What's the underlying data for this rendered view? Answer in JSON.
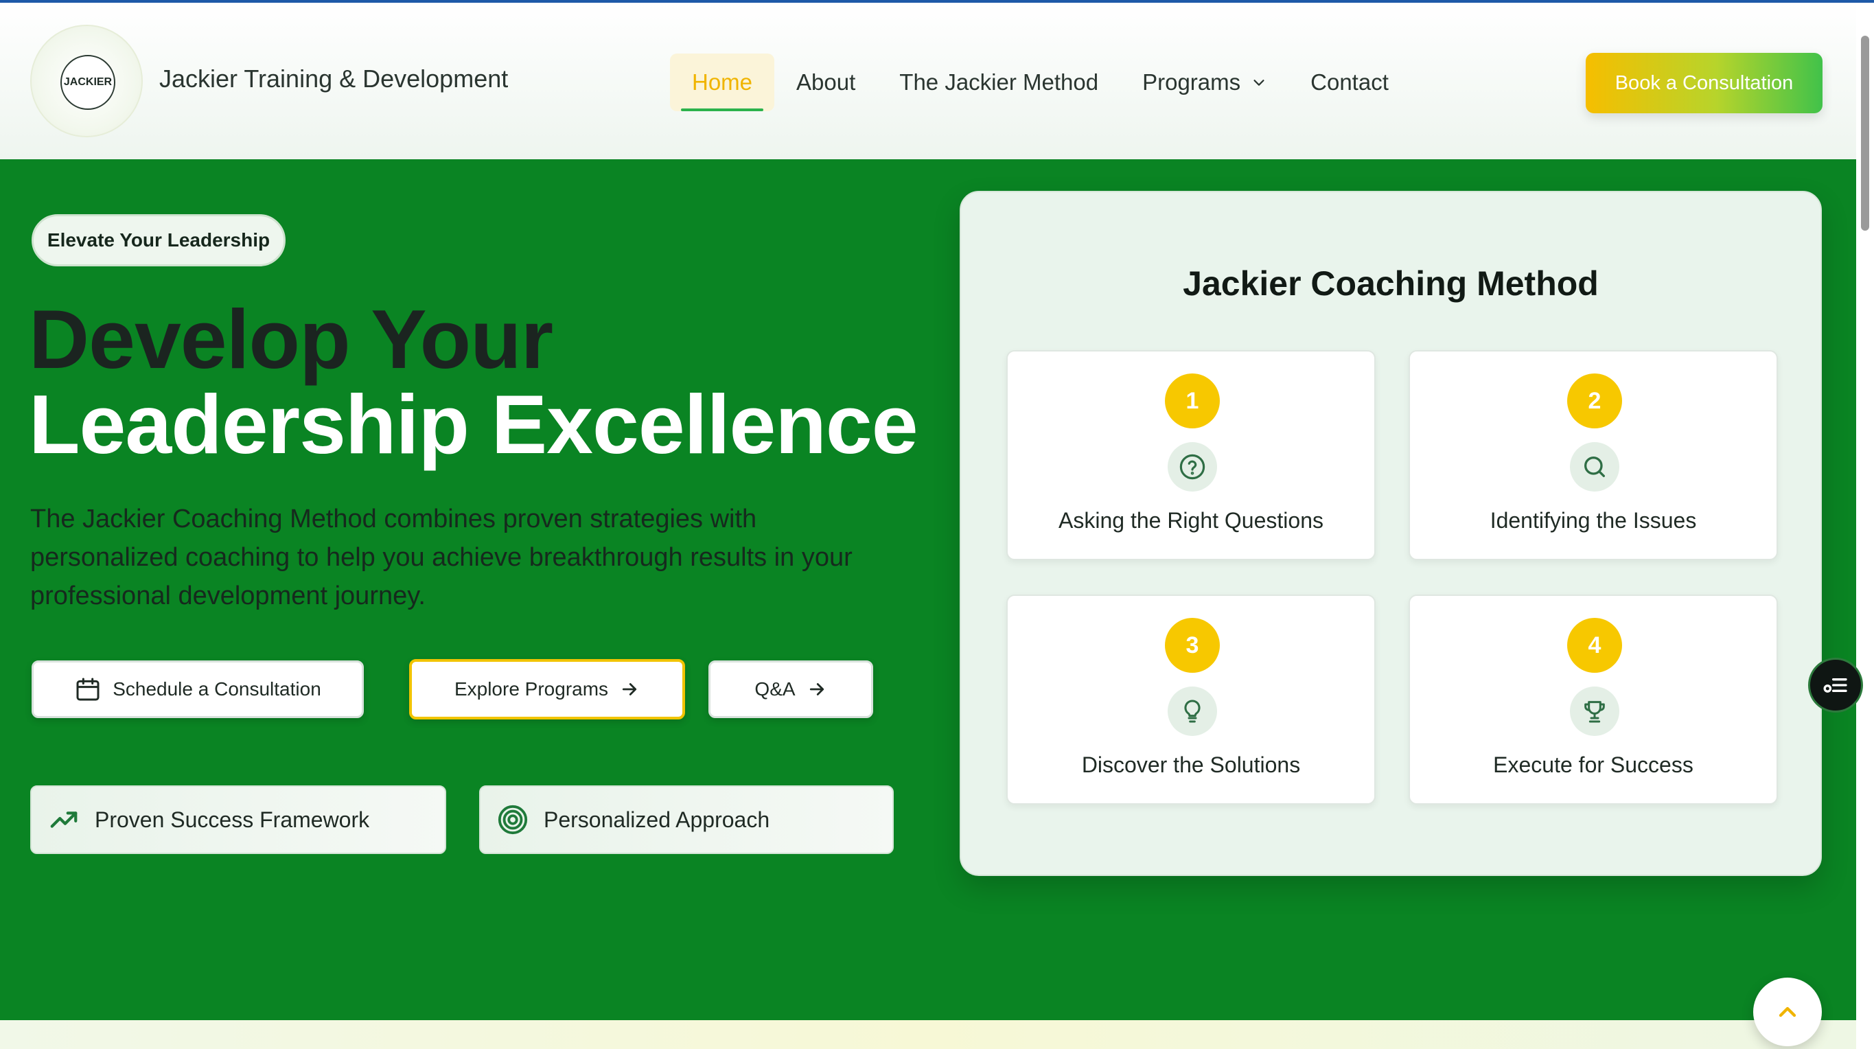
{
  "header": {
    "logo_text": "JACKIER",
    "brand": "Jackier Training & Development",
    "nav": [
      {
        "label": "Home",
        "active": true
      },
      {
        "label": "About"
      },
      {
        "label": "The Jackier Method"
      },
      {
        "label": "Programs",
        "has_dropdown": true
      },
      {
        "label": "Contact"
      }
    ],
    "cta": "Book a Consultation"
  },
  "hero": {
    "pill": "Elevate Your Leadership",
    "title_line1": "Develop Your",
    "title_line2": "Leadership Excellence",
    "lead": "The Jackier Coaching Method combines proven strategies with personalized coaching to help you achieve breakthrough results in your professional development journey.",
    "buttons": {
      "schedule": "Schedule a Consultation",
      "explore": "Explore Programs",
      "qa": "Q&A"
    },
    "features": [
      "Proven Success Framework",
      "Personalized Approach"
    ]
  },
  "method": {
    "title": "Jackier Coaching Method",
    "steps": [
      {
        "num": "1",
        "icon": "question-circle-icon",
        "label": "Asking the Right Questions"
      },
      {
        "num": "2",
        "icon": "search-icon",
        "label": "Identifying the Issues"
      },
      {
        "num": "3",
        "icon": "lightbulb-icon",
        "label": "Discover the Solutions"
      },
      {
        "num": "4",
        "icon": "trophy-icon",
        "label": "Execute for Success"
      }
    ]
  },
  "colors": {
    "hero_green": "#0a8423",
    "accent_yellow": "#f7c800",
    "nav_active": "#f0b400"
  }
}
